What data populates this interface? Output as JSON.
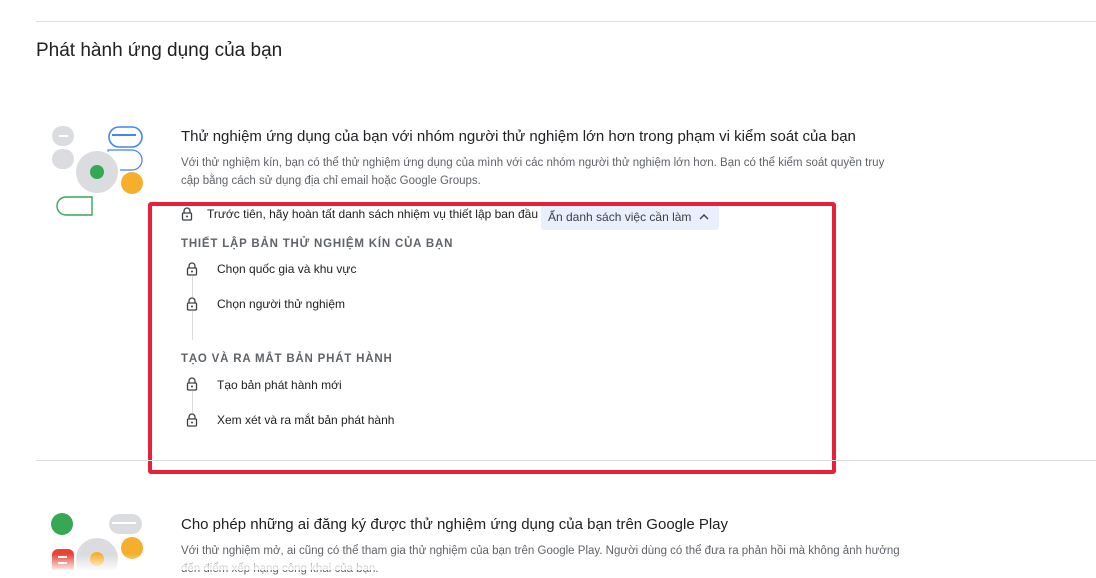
{
  "page": {
    "title": "Phát hành ứng dụng của bạn"
  },
  "closed_testing": {
    "title": "Thử nghiệm ứng dụng của bạn với nhóm người thử nghiệm lớn hơn trong phạm vi kiểm soát của bạn",
    "description": "Với thử nghiệm kín, bạn có thể thử nghiệm ứng dụng của mình với các nhóm người thử nghiệm lớn hơn. Bạn có thể kiểm soát quyền truy cập bằng cách sử dụng địa chỉ email hoặc Google Groups.",
    "prerequisite": "Trước tiên, hãy hoàn tất danh sách nhiệm vụ thiết lập ban đầu",
    "toggle_label": "Ẩn danh sách việc cần làm",
    "groups": [
      {
        "heading": "THIẾT LẬP BẢN THỬ NGHIỆM KÍN CỦA BẠN",
        "tasks": [
          "Chọn quốc gia và khu vực",
          "Chọn người thử nghiệm"
        ]
      },
      {
        "heading": "TẠO VÀ RA MẮT BẢN PHÁT HÀNH",
        "tasks": [
          "Tạo bản phát hành mới",
          "Xem xét và ra mắt bản phát hành"
        ]
      }
    ]
  },
  "open_testing": {
    "title": "Cho phép những ai đăng ký được thử nghiệm ứng dụng của bạn trên Google Play",
    "description": "Với thử nghiệm mở, ai cũng có thể tham gia thử nghiệm của bạn trên Google Play. Người dùng có thể đưa ra phản hồi mà không ảnh hưởng đến điểm xếp hạng công khai của bạn."
  },
  "colors": {
    "highlight": "#e8203a",
    "chip_bg": "#e8f0fe",
    "green": "#34a853",
    "yellow": "#f6ae2d",
    "red": "#ea4335",
    "blue": "#4285f4"
  },
  "icons": [
    "lock-icon",
    "chevron-up-icon"
  ]
}
